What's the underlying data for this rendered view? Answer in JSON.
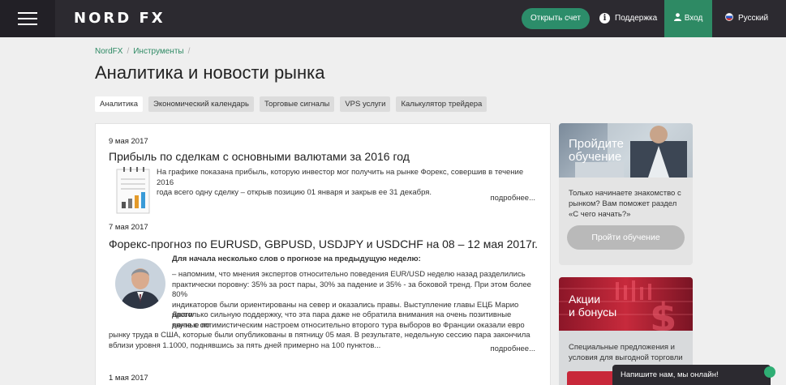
{
  "header": {
    "logo": {
      "part1": "NORD",
      "part2": "FX"
    },
    "open_account": "Открыть счет",
    "support": "Поддержка",
    "login": "Вход",
    "language": "Русский"
  },
  "breadcrumb": [
    "NordFX",
    "Инструменты"
  ],
  "page_title": "Аналитика и новости рынка",
  "tabs": [
    {
      "label": "Аналитика",
      "active": true
    },
    {
      "label": "Экономический календарь",
      "active": false
    },
    {
      "label": "Торговые сигналы",
      "active": false
    },
    {
      "label": "VPS услуги",
      "active": false
    },
    {
      "label": "Калькулятор трейдера",
      "active": false
    }
  ],
  "news": [
    {
      "date": "9 мая 2017",
      "title": "Прибыль по сделкам с основными валютами за 2016 год",
      "text_lines": [
        "На графике показана прибыль, которую инвестор мог получить на рынке Форекс, совершив в течение 2016",
        "года всего одну сделку – открыв позицию 01 января и закрыв ее 31 декабря."
      ],
      "more": "подробнее..."
    },
    {
      "date": "7 мая 2017",
      "title": "Форекс-прогноз по EURUSD, GBPUSD, USDJPY и USDCHF на 08 – 12 мая 2017г.",
      "lead": "Для начала несколько слов о прогнозе на предыдущую неделю:",
      "text_lines": [
        "– напомним, что мнения экспертов относительно поведения EUR/USD неделю назад разделились",
        "практически поровну: 35% за рост пары, 30% за падение и 35% - за боковой тренд. При этом более 80%",
        "индикаторов были ориентированы на север и оказались правы. Выступление главы ЕЦБ Марио Драги",
        "вкупе с оптимистическим настроем относительно второго тура выборов во Франции оказали евро",
        "настолько сильную поддержку, что эта пара даже не обратила внимания на очень позитивные данные по",
        "рынку труда в США, которые были опубликованы в пятницу 05 мая. В результате, недельную сессию пара закончила",
        "вблизи уровня 1.1000, поднявшись за пять дней примерно на 100 пунктов..."
      ],
      "more": "подробнее..."
    },
    {
      "date": "1 мая 2017"
    }
  ],
  "promo_education": {
    "title_line1": "Пройдите",
    "title_line2": "обучение",
    "desc": "Только начинаете знакомство с рынком? Вам поможет раздел «С чего начать?»",
    "button": "Пройти обучение"
  },
  "promo_bonus": {
    "title_line1": "Акции",
    "title_line2": "и бонусы",
    "desc": "Специальные предложения и условия для выгодной торговли"
  },
  "chat": {
    "label": "Напишите нам, мы онлайн!"
  },
  "colors": {
    "accent": "#2e8a64",
    "header_bg": "#2c2a30",
    "promo_red": "#c72a3c"
  }
}
